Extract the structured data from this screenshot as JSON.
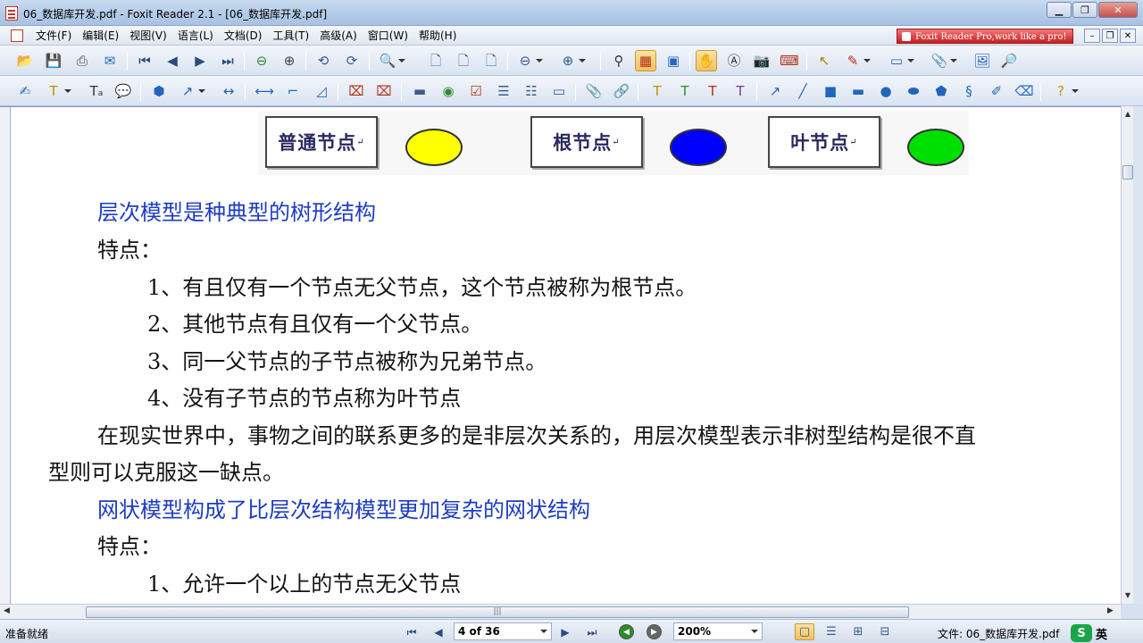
{
  "window": {
    "title": "06_数据库开发.pdf - Foxit Reader 2.1 - [06_数据库开发.pdf]",
    "minimize": "▁",
    "restore": "❐",
    "close": "✕"
  },
  "menu": {
    "items": [
      "文件(F)",
      "编辑(E)",
      "视图(V)",
      "语言(L)",
      "文档(D)",
      "工具(T)",
      "高级(A)",
      "窗口(W)",
      "帮助(H)"
    ],
    "promo": "Foxit Reader Pro,work like a pro!",
    "mdi": [
      "–",
      "❐",
      "✕"
    ]
  },
  "legend": {
    "items": [
      {
        "label": "普通节点",
        "mark": "↵",
        "color": "#ffff00"
      },
      {
        "label": "根节点",
        "mark": "↵",
        "color": "#0000ff"
      },
      {
        "label": "叶节点",
        "mark": "↵",
        "color": "#00e000"
      }
    ]
  },
  "document": {
    "lines": [
      {
        "text": "层次模型是种典型的树形结构",
        "style": "heading"
      },
      {
        "text": "特点：",
        "style": "normal"
      },
      {
        "text": "1、有且仅有一个节点无父节点，这个节点被称为根节点。",
        "style": "normal"
      },
      {
        "text": "2、其他节点有且仅有一个父节点。",
        "style": "normal"
      },
      {
        "text": "3、同一父节点的子节点被称为兄弟节点。",
        "style": "normal"
      },
      {
        "text": "4、没有子节点的节点称为叶节点",
        "style": "normal"
      },
      {
        "text": "在现实世界中，事物之间的联系更多的是非层次关系的，用层次模型表示非树型结构是很不直",
        "style": "normal"
      },
      {
        "text": "型则可以克服这一缺点。",
        "style": "normal"
      },
      {
        "text": "网状模型构成了比层次结构模型更加复杂的网状结构",
        "style": "heading"
      },
      {
        "text": "特点：",
        "style": "normal"
      },
      {
        "text": "1、允许一个以上的节点无父节点",
        "style": "normal"
      }
    ]
  },
  "statusbar": {
    "status": "准备就绪",
    "page": "4 of 36",
    "zoom": "200%",
    "file_info": "文件: 06_数据库开发.pdf",
    "ime_label": "英",
    "ime_logo": "S"
  },
  "hscroll_grip": "|||",
  "colors": {
    "heading_text": "#1c3cc2",
    "body_text": "#141414",
    "accent": "#f1c15d"
  }
}
